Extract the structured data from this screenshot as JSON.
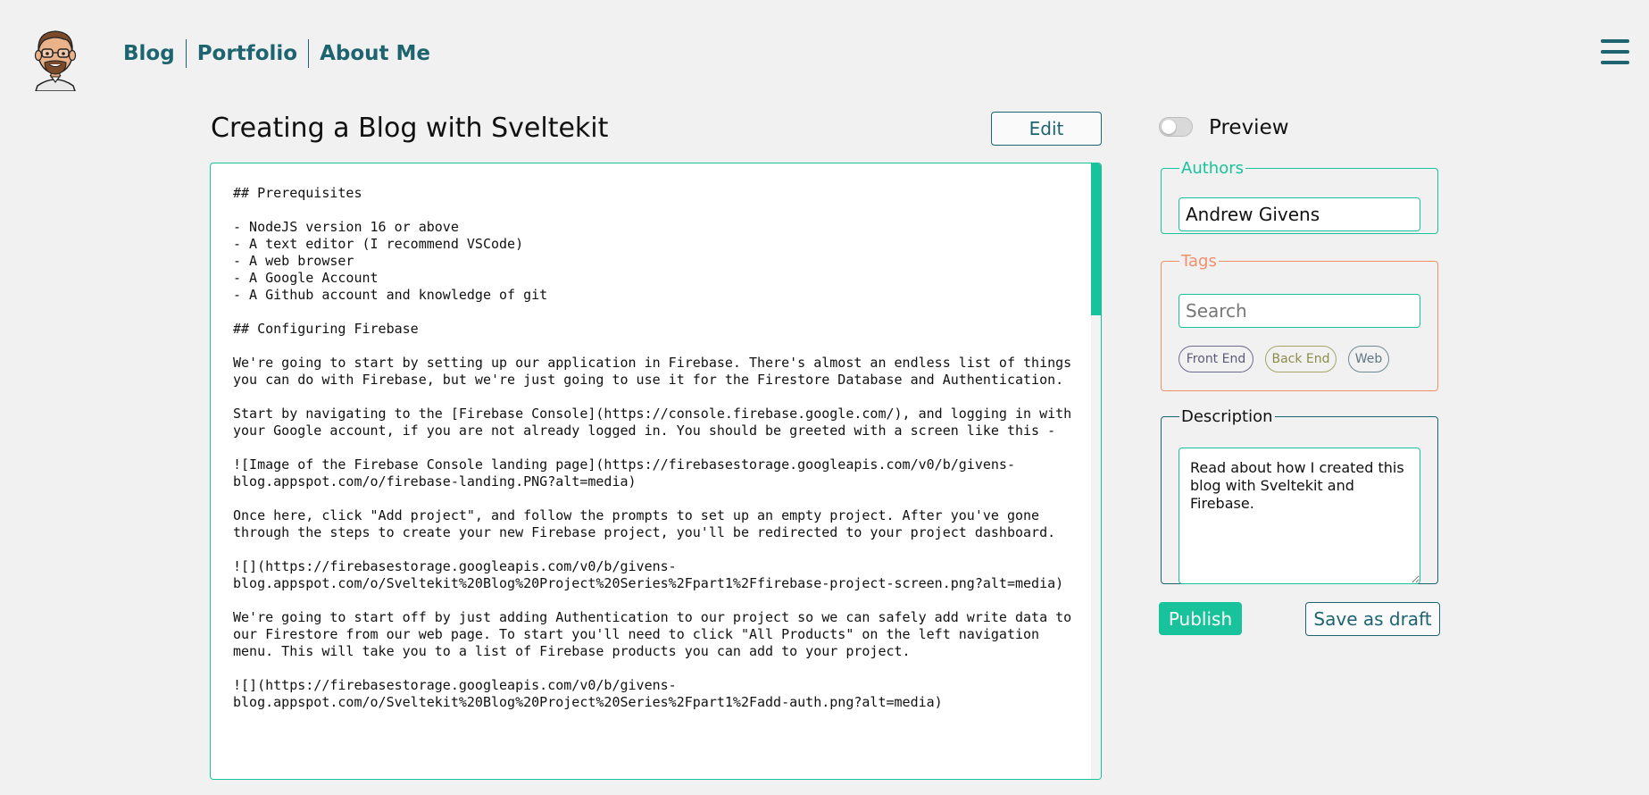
{
  "nav": {
    "links": [
      "Blog",
      "Portfolio",
      "About Me"
    ]
  },
  "post": {
    "title": "Creating a Blog with Sveltekit",
    "edit_label": "Edit",
    "content": "## Prerequisites\n\n- NodeJS version 16 or above\n- A text editor (I recommend VSCode)\n- A web browser\n- A Google Account\n- A Github account and knowledge of git\n\n## Configuring Firebase\n\nWe're going to start by setting up our application in Firebase. There's almost an endless list of things you can do with Firebase, but we're just going to use it for the Firestore Database and Authentication.\n\nStart by navigating to the [Firebase Console](https://console.firebase.google.com/), and logging in with your Google account, if you are not already logged in. You should be greeted with a screen like this -\n\n![Image of the Firebase Console landing page](https://firebasestorage.googleapis.com/v0/b/givens-blog.appspot.com/o/firebase-landing.PNG?alt=media)\n\nOnce here, click \"Add project\", and follow the prompts to set up an empty project. After you've gone through the steps to create your new Firebase project, you'll be redirected to your project dashboard.\n\n![](https://firebasestorage.googleapis.com/v0/b/givens-blog.appspot.com/o/Sveltekit%20Blog%20Project%20Series%2Fpart1%2Ffirebase-project-screen.png?alt=media)\n\nWe're going to start off by just adding Authentication to our project so we can safely add write data to our Firestore from our web page. To start you'll need to click \"All Products\" on the left navigation menu. This will take you to a list of Firebase products you can add to your project.\n\n![](https://firebasestorage.googleapis.com/v0/b/givens-blog.appspot.com/o/Sveltekit%20Blog%20Project%20Series%2Fpart1%2Fadd-auth.png?alt=media)"
  },
  "sidebar": {
    "preview_label": "Preview",
    "preview_enabled": false,
    "authors": {
      "legend": "Authors",
      "value": "Andrew Givens"
    },
    "tags": {
      "legend": "Tags",
      "placeholder": "Search",
      "chips": [
        "Front End",
        "Back End",
        "Web"
      ]
    },
    "description": {
      "legend": "Description",
      "value": "Read about how I created this blog with Sveltekit and Firebase."
    },
    "publish_label": "Publish",
    "draft_label": "Save as draft"
  },
  "colors": {
    "accent": "#18c39b",
    "brand": "#1d6470",
    "tags_border": "#f0906a",
    "background": "#f1f1f1"
  },
  "icons": {
    "avatar": "cartoon-avatar",
    "menu": "hamburger-menu-icon"
  }
}
